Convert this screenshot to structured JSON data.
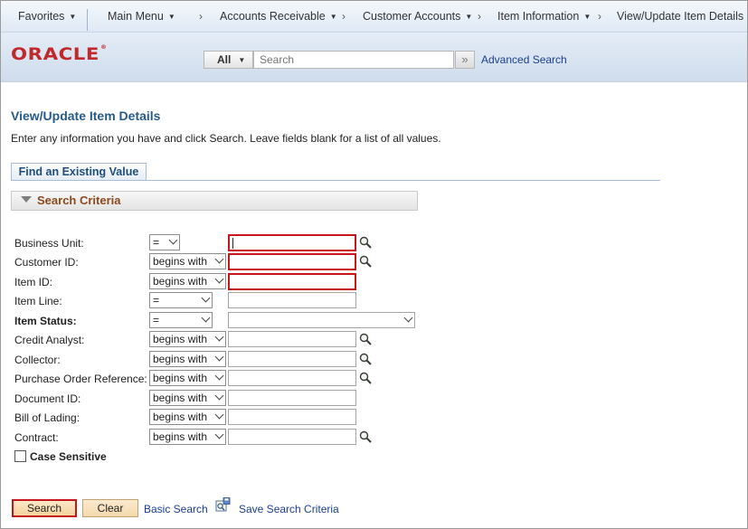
{
  "nav": {
    "favorites": "Favorites",
    "main_menu": "Main Menu",
    "crumbs": [
      "Accounts Receivable",
      "Customer Accounts",
      "Item Information",
      "View/Update Item Details"
    ]
  },
  "banner": {
    "logo": "ORACLE",
    "search_scope": "All",
    "search_placeholder": "Search",
    "advanced_search": "Advanced Search"
  },
  "page": {
    "title": "View/Update Item Details",
    "instructions": "Enter any information you have and click Search. Leave fields blank for a list of all values.",
    "tab": "Find an Existing Value",
    "section": "Search Criteria"
  },
  "fields": [
    {
      "label": "Business Unit:",
      "operator": "="
    },
    {
      "label": "Customer ID:",
      "operator": "begins with"
    },
    {
      "label": "Item ID:",
      "operator": "begins with"
    },
    {
      "label": "Item Line:",
      "operator": "="
    },
    {
      "label": "Item Status:",
      "operator": "="
    },
    {
      "label": "Credit Analyst:",
      "operator": "begins with"
    },
    {
      "label": "Collector:",
      "operator": "begins with"
    },
    {
      "label": "Purchase Order Reference:",
      "operator": "begins with"
    },
    {
      "label": "Document ID:",
      "operator": "begins with"
    },
    {
      "label": "Bill of Lading:",
      "operator": "begins with"
    },
    {
      "label": "Contract:",
      "operator": "begins with"
    }
  ],
  "options": {
    "case_sensitive": "Case Sensitive"
  },
  "actions": {
    "search": "Search",
    "clear": "Clear",
    "basic_search": "Basic Search",
    "save_search": "Save Search Criteria"
  },
  "colors": {
    "required_border": "#c4161c",
    "title": "#285a89",
    "link": "#1a3f8f",
    "logo": "#c0282c"
  }
}
